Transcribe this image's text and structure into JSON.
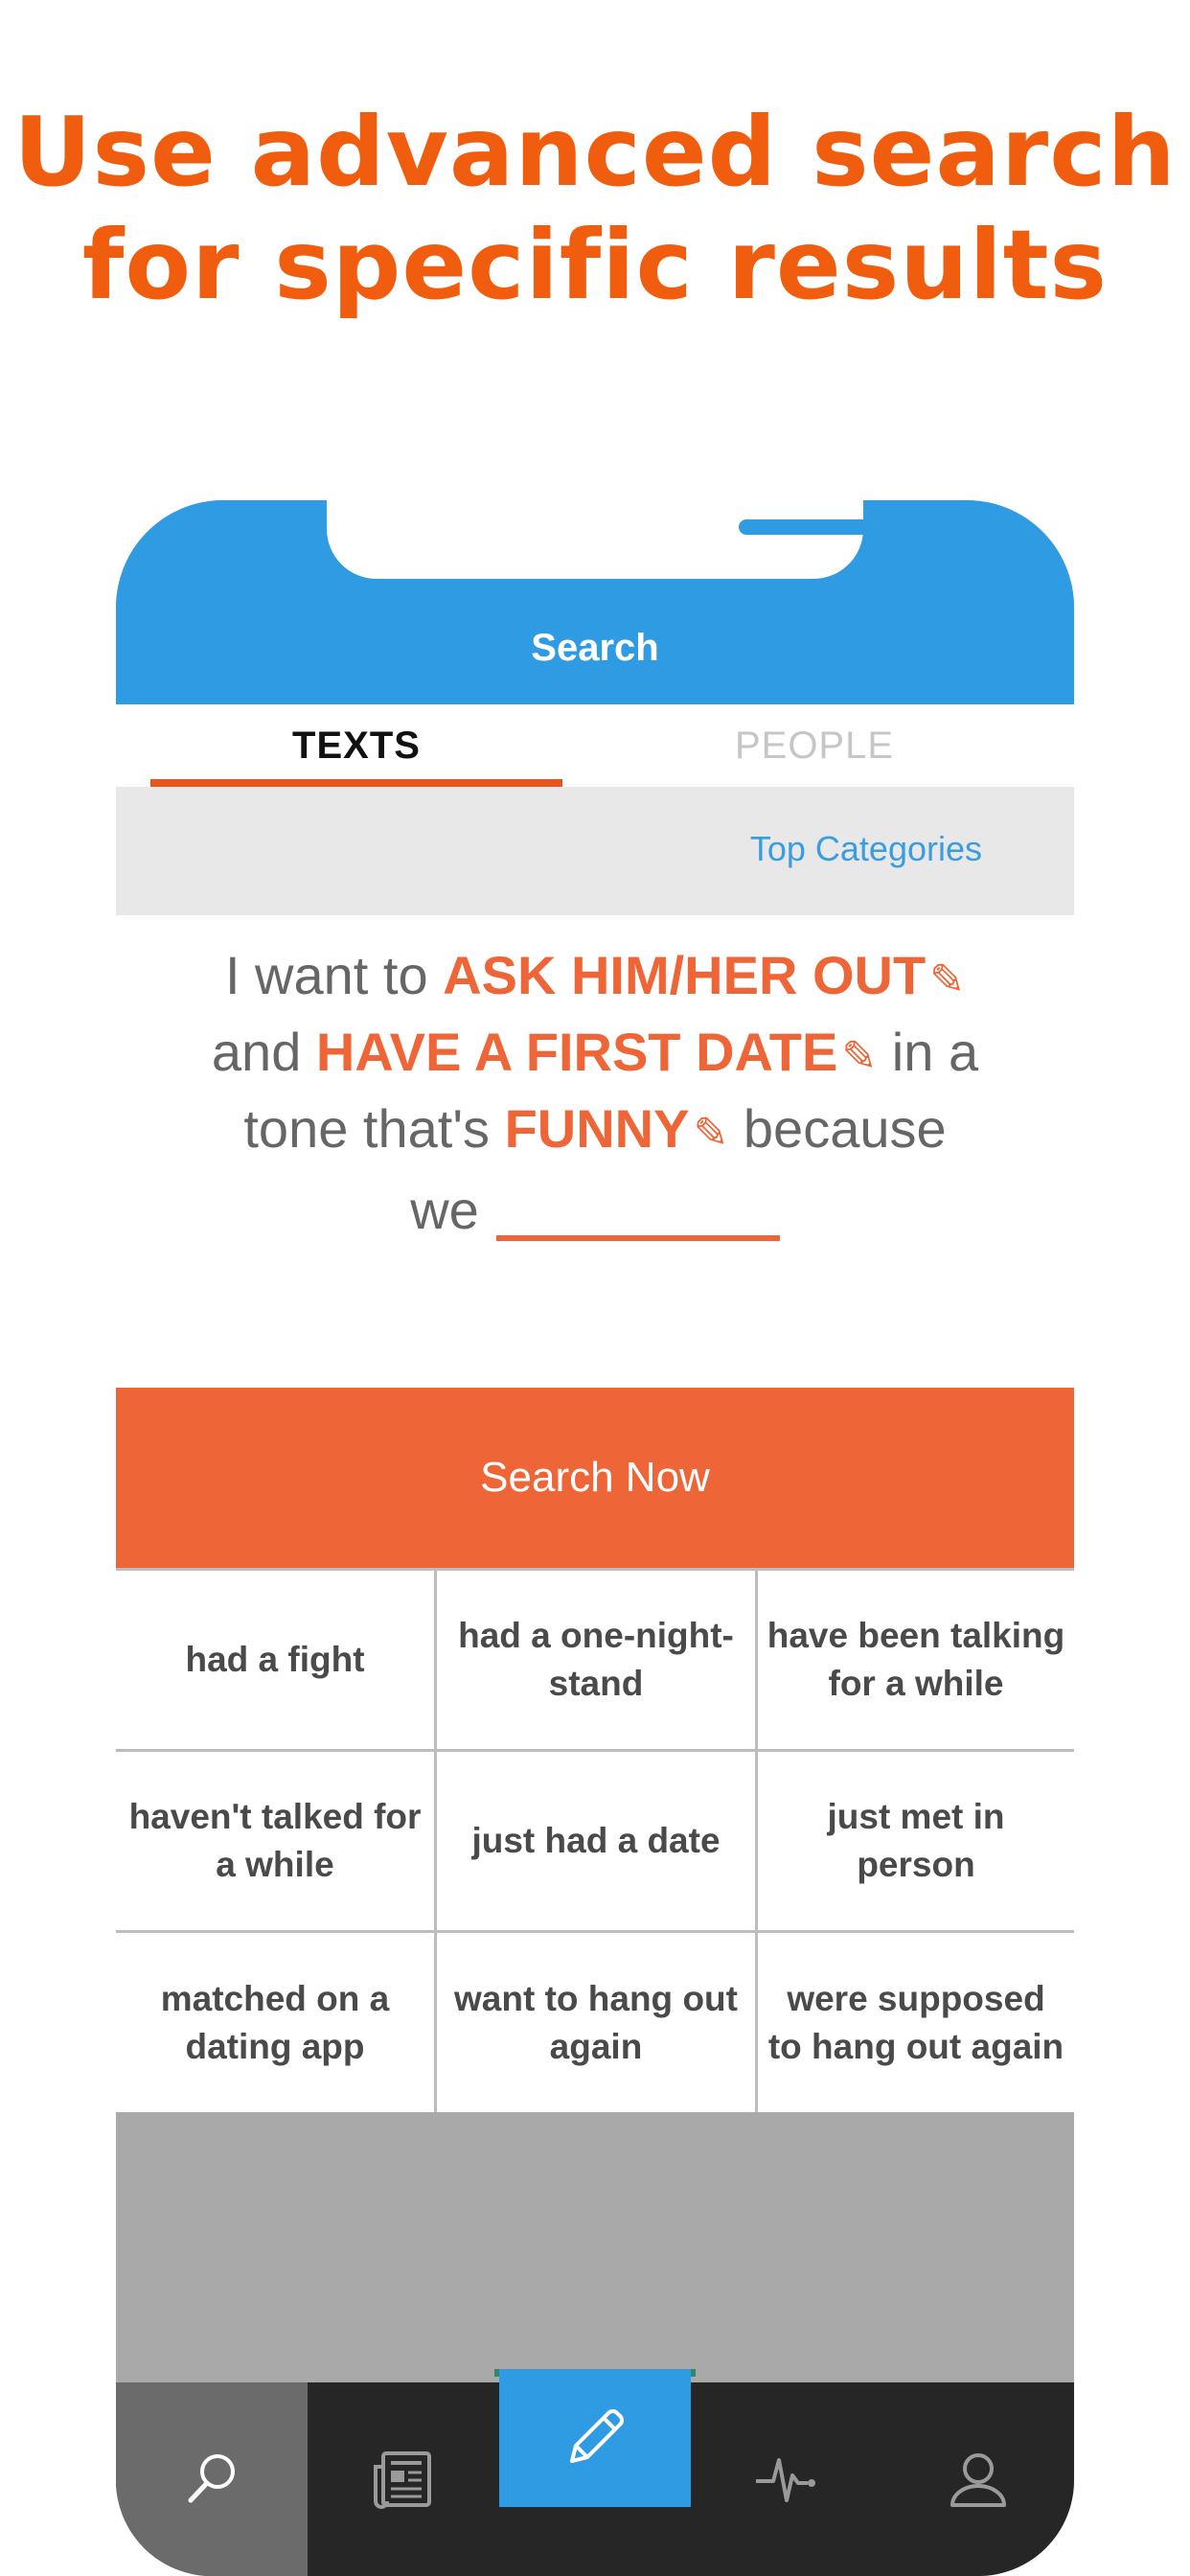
{
  "headline": {
    "line1": "Use advanced search",
    "line2": "for specific results"
  },
  "header": {
    "title": "Search"
  },
  "tabs": [
    {
      "label": "TEXTS",
      "active": true
    },
    {
      "label": "PEOPLE",
      "active": false
    }
  ],
  "categories": {
    "link_label": "Top Categories"
  },
  "sentence": {
    "part1": "I want to",
    "keyword1": "ASK HIM/HER OUT",
    "part2": "and",
    "keyword2": "HAVE A FIRST DATE",
    "part3": "in a",
    "part4": "tone that's",
    "keyword3": "FUNNY",
    "part5": "because",
    "part6": "we"
  },
  "search_button": {
    "label": "Search Now"
  },
  "options": [
    "had a fight",
    "had a one-night-stand",
    "have been talking for a while",
    "haven't talked for a while",
    "just had a date",
    "just met in person",
    "matched on a dating app",
    "want to hang out again",
    "were supposed to hang out again"
  ],
  "tab_bar": {
    "items": [
      {
        "icon": "search-icon",
        "active": true
      },
      {
        "icon": "newspaper-icon",
        "active": false
      },
      {
        "icon": "pencil-icon",
        "active": false
      },
      {
        "icon": "activity-icon",
        "active": false
      },
      {
        "icon": "profile-icon",
        "active": false
      }
    ]
  },
  "colors": {
    "accent_orange": "#ee6638",
    "headline_orange": "#f15d0f",
    "primary_blue": "#2f9be3"
  }
}
